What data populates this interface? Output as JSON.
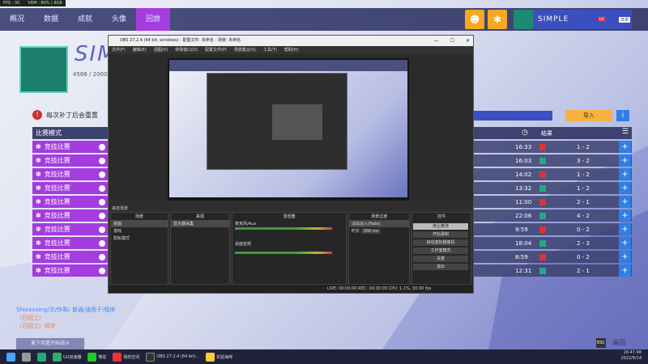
{
  "perf": {
    "fps": "FPS : 30",
    "mem": "VRM : 80% | 8GB"
  },
  "nav": {
    "tabs": [
      "概况",
      "数据",
      "成就",
      "头像",
      "回放"
    ],
    "active": "回放"
  },
  "profile": {
    "name": "SIMPLE",
    "badge_level": "LV",
    "badge_extra": "日本"
  },
  "hero": {
    "name": "SIMP",
    "score": "4566 / 20000"
  },
  "warning": "每次补丁后会重置",
  "filter": {
    "import_label": "导入",
    "info": "i"
  },
  "modes": {
    "header": "比赛模式",
    "items": [
      "竞技比赛",
      "竞技比赛",
      "竞技比赛",
      "竞技比赛",
      "竞技比赛",
      "竞技比赛",
      "竞技比赛",
      "竞技比赛",
      "竞技比赛",
      "竞技比赛"
    ]
  },
  "table": {
    "header_result": "结果",
    "rows": [
      {
        "time": "16:33",
        "score": "1 - 2"
      },
      {
        "time": "16:03",
        "score": "3 - 2"
      },
      {
        "time": "14:02",
        "score": "1 - 2"
      },
      {
        "time": "13:32",
        "score": "1 - 2"
      },
      {
        "time": "11:00",
        "score": "2 - 1"
      },
      {
        "time": "22:06",
        "score": "4 - 2"
      },
      {
        "time": "9:59",
        "score": "0 - 2"
      },
      {
        "time": "18:04",
        "score": "2 - 3"
      },
      {
        "time": "8:59",
        "score": "0 - 2"
      },
      {
        "time": "12:31",
        "score": "2 - 1"
      }
    ]
  },
  "notes": {
    "line1": "Sfxxxxxing/次/炸客/ 普通/通用于/程序",
    "line2": "（已回上）",
    "line3": "（已回上）同步"
  },
  "bottom_button": "离下到重开始战斗",
  "esc": "ESC",
  "back": "返回",
  "obs": {
    "title": "OBS 27.2.4 (64 bit, windows) - 配置文件: 未命名 - 场景: 未命名",
    "menu": [
      "文件(F)",
      "编辑(E)",
      "视图(V)",
      "停靠窗口(D)",
      "配置文件(P)",
      "场景集合(S)",
      "工具(T)",
      "帮助(H)"
    ],
    "scenes_header": "场景",
    "scenes": [
      "桌面",
      "游戏",
      "隐私模式"
    ],
    "sources_header": "来源",
    "source_item": "显示器采集",
    "mixer_header": "混音器",
    "mixer_ch1": "麦克风/Aux",
    "mixer_ch2": "桌面音频",
    "transition_header": "场景过渡",
    "transition_value": "淡出淡入(Fade)",
    "duration_label": "时长",
    "duration_value": "300 ms",
    "controls_header": "控件",
    "controls": [
      "停止推流",
      "开始录制",
      "启动虚拟摄像机",
      "工作室模式",
      "设置",
      "退出"
    ],
    "status": "LIVE: 00:00:00   REC: 00:00:00   CPU: 1.1%, 30.00 fps",
    "from_scene": "来自场景"
  },
  "taskbar": {
    "items": [
      "UU加速器",
      "微信",
      "我的空间",
      "OBS 27.2.4 (64 bit)...",
      "实验海绵"
    ],
    "time": "16:47:48",
    "date": "2022/9/14"
  }
}
